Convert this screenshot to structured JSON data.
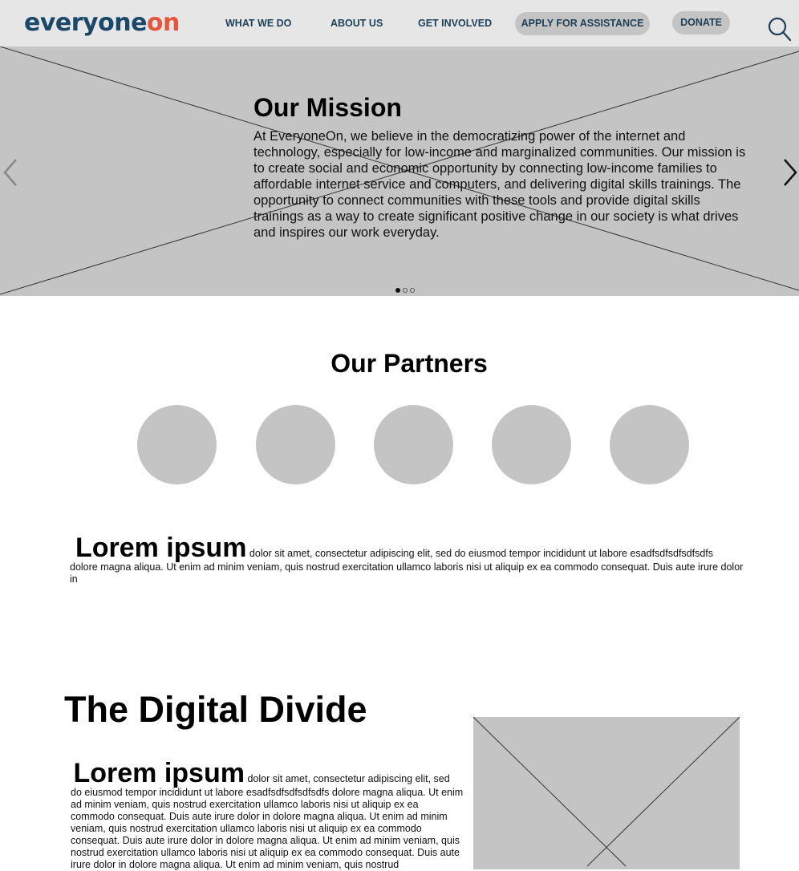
{
  "header": {
    "logo_part1": "everyone",
    "logo_part2": "on",
    "nav": {
      "what_we_do": "WHAT WE DO",
      "about_us": "ABOUT US",
      "get_involved": "GET INVOLVED",
      "apply": "APPLY FOR ASSISTANCE",
      "donate": "DONATE"
    },
    "search_icon": "search-icon"
  },
  "hero": {
    "title": "Our Mission",
    "text": "At EveryoneOn, we believe in the democratizing power of the internet and technology, especially for low-income and marginalized communities. Our mission is to create social and economic opportunity by connecting low-income families to affordable internet service and computers, and delivering digital skills trainings. The opportunity to connect communities with these tools and provide digital skills trainings as a way to create significant positive change in our society is what drives and inspires our work everyday.",
    "prev_icon": "chevron-left-icon",
    "next_icon": "chevron-right-icon",
    "slide_count": 3,
    "active_slide": 1
  },
  "partners": {
    "title": "Our Partners",
    "logo_count": 5
  },
  "intro": {
    "lead": "Lorem ipsum",
    "text": "dolor sit amet, consectetur adipiscing elit, sed do eiusmod tempor incididunt ut labore esadfsdfsdfsdfsdfs dolore magna aliqua. Ut enim ad minim veniam, quis nostrud exercitation ullamco laboris nisi ut aliquip ex ea commodo consequat. Duis aute irure dolor in"
  },
  "digital_divide": {
    "title": "The Digital Divide",
    "lead": "Lorem ipsum",
    "text": "dolor sit amet, consectetur adipiscing elit, sed do eiusmod tempor incididunt ut labore esadfsdfsdfsdfsdfs dolore magna aliqua. Ut enim ad minim veniam, quis nostrud exercitation ullamco laboris nisi ut aliquip ex ea commodo consequat. Duis aute irure dolor in dolore magna aliqua. Ut enim ad minim veniam, quis nostrud exercitation ullamco laboris nisi ut aliquip ex ea commodo consequat. Duis aute irure dolor in dolore magna aliqua. Ut enim ad minim veniam, quis nostrud exercitation ullamco laboris nisi ut aliquip ex ea commodo consequat. Duis aute irure dolor in dolore magna aliqua. Ut enim ad minim veniam, quis nostrud"
  },
  "colors": {
    "header_bg": "#e6e6e6",
    "placeholder_gray": "#c4c4c4",
    "brand_navy": "#1a4869",
    "brand_orange": "#e2583e"
  }
}
